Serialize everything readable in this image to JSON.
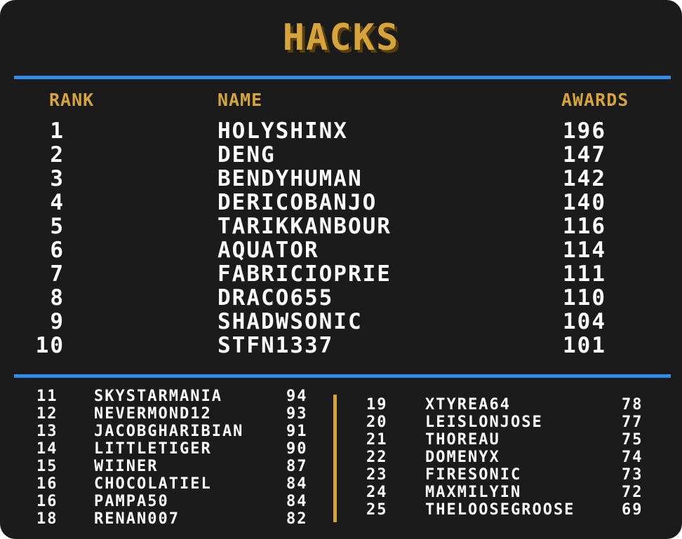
{
  "title": "HACKS",
  "headers": {
    "rank": "RANK",
    "name": "NAME",
    "awards": "AWARDS"
  },
  "top": [
    {
      "rank": "1",
      "name": "HOLYSHINX",
      "awards": "196"
    },
    {
      "rank": "2",
      "name": "DENG",
      "awards": "147"
    },
    {
      "rank": "3",
      "name": "BENDYHUMAN",
      "awards": "142"
    },
    {
      "rank": "4",
      "name": "DERICOBANJO",
      "awards": "140"
    },
    {
      "rank": "5",
      "name": "TARIKKANBOUR",
      "awards": "116"
    },
    {
      "rank": "6",
      "name": "AQUATOR",
      "awards": "114"
    },
    {
      "rank": "7",
      "name": "FABRICIOPRIE",
      "awards": "111"
    },
    {
      "rank": "8",
      "name": "DRACO655",
      "awards": "110"
    },
    {
      "rank": "9",
      "name": "SHADWSONIC",
      "awards": "104"
    },
    {
      "rank": "10",
      "name": "STFN1337",
      "awards": "101"
    }
  ],
  "left_column": [
    {
      "rank": "11",
      "name": "SKYSTARMANIA",
      "awards": "94"
    },
    {
      "rank": "12",
      "name": "NEVERMOND12",
      "awards": "93"
    },
    {
      "rank": "13",
      "name": "JACOBGHARIBIAN",
      "awards": "91"
    },
    {
      "rank": "14",
      "name": "LITTLETIGER",
      "awards": "90"
    },
    {
      "rank": "15",
      "name": "WIINER",
      "awards": "87"
    },
    {
      "rank": "16",
      "name": "CHOCOLATIEL",
      "awards": "84"
    },
    {
      "rank": "16",
      "name": "PAMPA50",
      "awards": "84"
    },
    {
      "rank": "18",
      "name": "RENAN007",
      "awards": "82"
    }
  ],
  "right_column": [
    {
      "rank": "19",
      "name": "XTYREA64",
      "awards": "78"
    },
    {
      "rank": "20",
      "name": "LEISLONJOSE",
      "awards": "77"
    },
    {
      "rank": "21",
      "name": "THOREAU",
      "awards": "75"
    },
    {
      "rank": "22",
      "name": "DOMENYX",
      "awards": "74"
    },
    {
      "rank": "23",
      "name": "FIRESONIC",
      "awards": "73"
    },
    {
      "rank": "24",
      "name": "MAXMILYIN",
      "awards": "72"
    },
    {
      "rank": "25",
      "name": "THELOOSEGROOSE",
      "awards": "69"
    }
  ],
  "colors": {
    "background": "#1b1b1b",
    "accent_gold": "#d6a43c",
    "rule_blue": "#2f8eea",
    "text": "#ffffff"
  }
}
